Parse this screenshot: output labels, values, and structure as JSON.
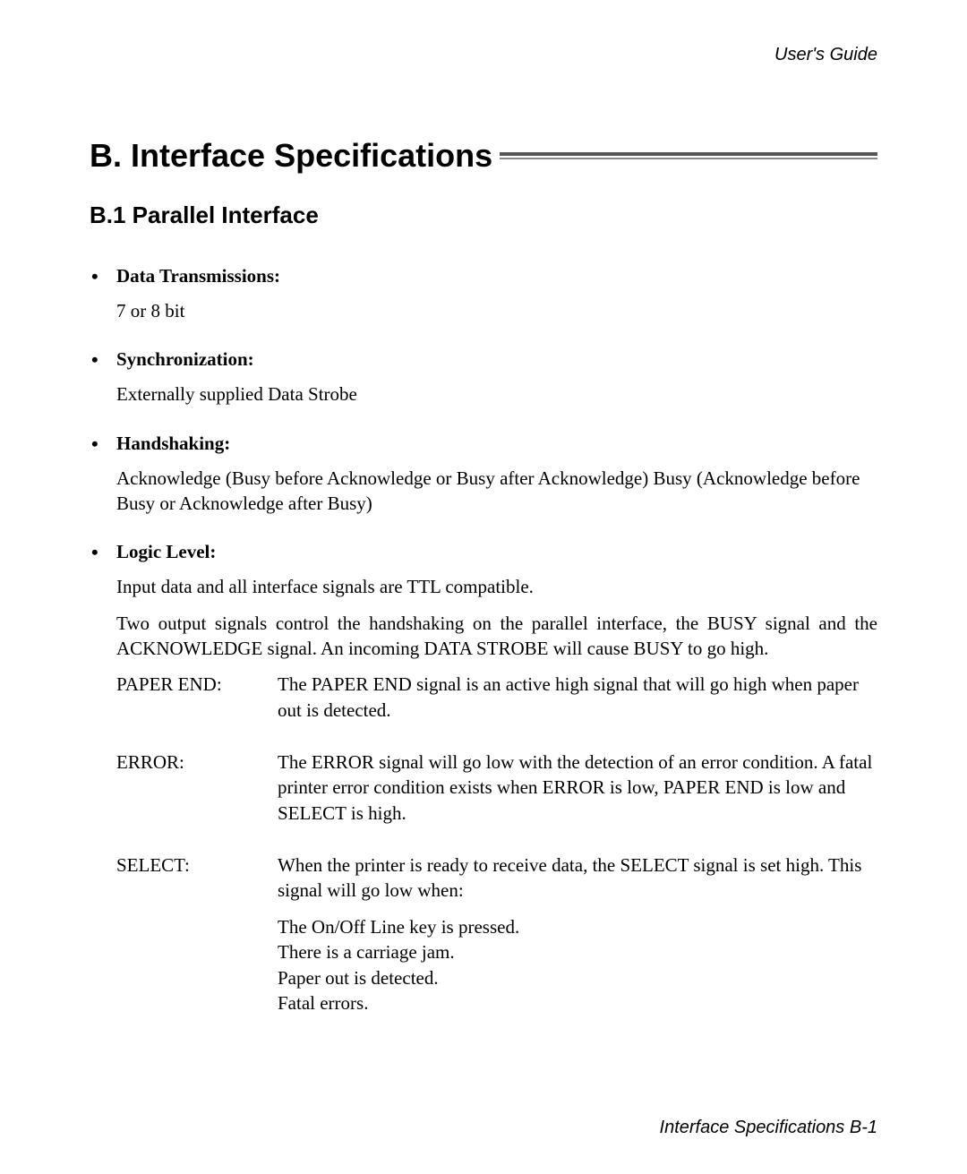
{
  "header": "User's Guide",
  "title": "B.   Interface Specifications",
  "subheading": "B.1   Parallel Interface",
  "items": [
    {
      "head": "Data Transmissions:",
      "body": [
        "7 or 8 bit"
      ]
    },
    {
      "head": "Synchronization:",
      "body": [
        "Externally supplied Data Strobe"
      ]
    },
    {
      "head": "Handshaking:",
      "body": [
        "Acknowledge (Busy before Acknowledge or Busy after Acknowledge) Busy (Acknowledge before Busy or Acknowledge after Busy)"
      ]
    },
    {
      "head": "Logic Level:",
      "body": [
        "Input data and all interface signals are TTL compatible.",
        "Two output signals control the handshaking on the parallel interface, the BUSY signal and the ACKNOWLEDGE signal.  An incoming DATA STROBE will cause BUSY to go high."
      ],
      "signals": [
        {
          "name": "PAPER END:",
          "desc": [
            "The PAPER END signal is an active high signal that will go high when paper out is detected."
          ]
        },
        {
          "name": "ERROR:",
          "desc": [
            "The ERROR signal will go low with the detection of an error condition. A fatal printer error condition exists when ERROR is low, PAPER END is low and SELECT is high."
          ]
        },
        {
          "name": "SELECT:",
          "desc": [
            "When the printer is ready to receive data, the SELECT signal is set high. This signal will go low when:",
            "The On/Off Line key is pressed.\nThere is a carriage jam.\nPaper out is detected.\nFatal errors."
          ]
        }
      ]
    }
  ],
  "footer": "Interface Specifications  B-1"
}
